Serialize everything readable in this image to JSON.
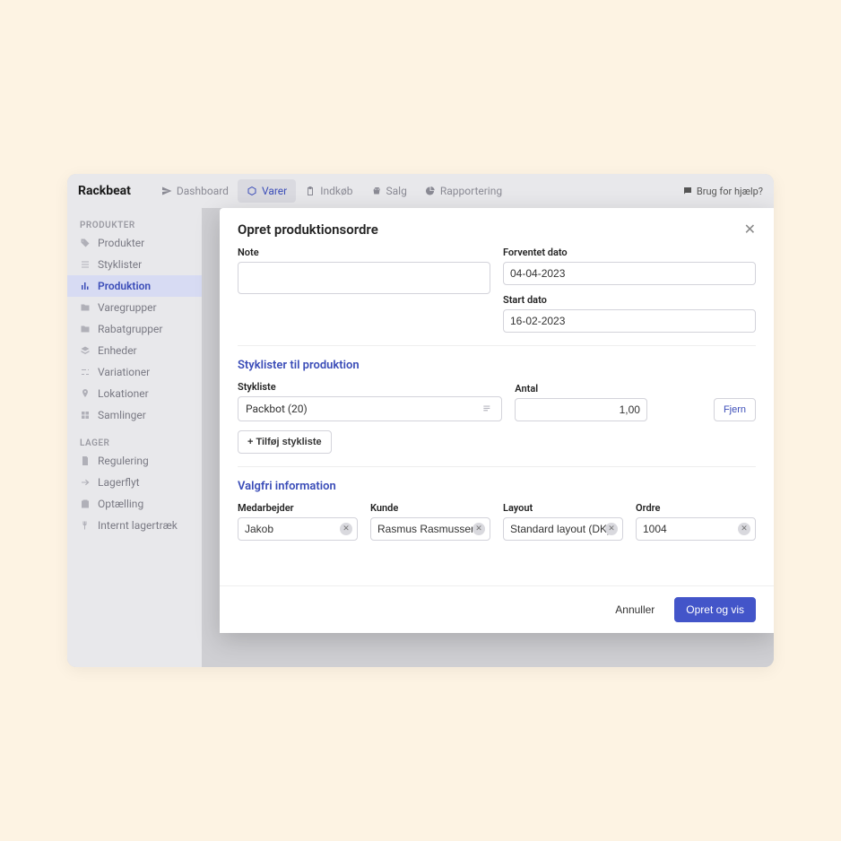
{
  "brand": "Rackbeat",
  "topnav": {
    "items": [
      {
        "label": "Dashboard"
      },
      {
        "label": "Varer"
      },
      {
        "label": "Indkøb"
      },
      {
        "label": "Salg"
      },
      {
        "label": "Rapportering"
      }
    ],
    "help": "Brug for hjælp?"
  },
  "sidebar": {
    "group1": "PRODUKTER",
    "group2": "LAGER",
    "items1": [
      {
        "label": "Produkter"
      },
      {
        "label": "Styklister"
      },
      {
        "label": "Produktion"
      },
      {
        "label": "Varegrupper"
      },
      {
        "label": "Rabatgrupper"
      },
      {
        "label": "Enheder"
      },
      {
        "label": "Variationer"
      },
      {
        "label": "Lokationer"
      },
      {
        "label": "Samlinger"
      }
    ],
    "items2": [
      {
        "label": "Regulering"
      },
      {
        "label": "Lagerflyt"
      },
      {
        "label": "Optælling"
      },
      {
        "label": "Internt lagertræk"
      }
    ]
  },
  "modal": {
    "title": "Opret produktionsordre",
    "note_label": "Note",
    "note_value": "",
    "expected_label": "Forventet dato",
    "expected_value": "04-04-2023",
    "start_label": "Start dato",
    "start_value": "16-02-2023",
    "boms_title": "Styklister til produktion",
    "bom_label": "Stykliste",
    "bom_value": "Packbot (20)",
    "qty_label": "Antal",
    "qty_value": "1,00",
    "remove": "Fjern",
    "add_bom": "+ Tilføj stykliste",
    "optional_title": "Valgfri information",
    "employee_label": "Medarbejder",
    "employee_value": "Jakob",
    "customer_label": "Kunde",
    "customer_value": "Rasmus Rasmussen",
    "layout_label": "Layout",
    "layout_value": "Standard layout (DK)",
    "order_label": "Ordre",
    "order_value": "1004",
    "cancel": "Annuller",
    "submit": "Opret og vis"
  }
}
